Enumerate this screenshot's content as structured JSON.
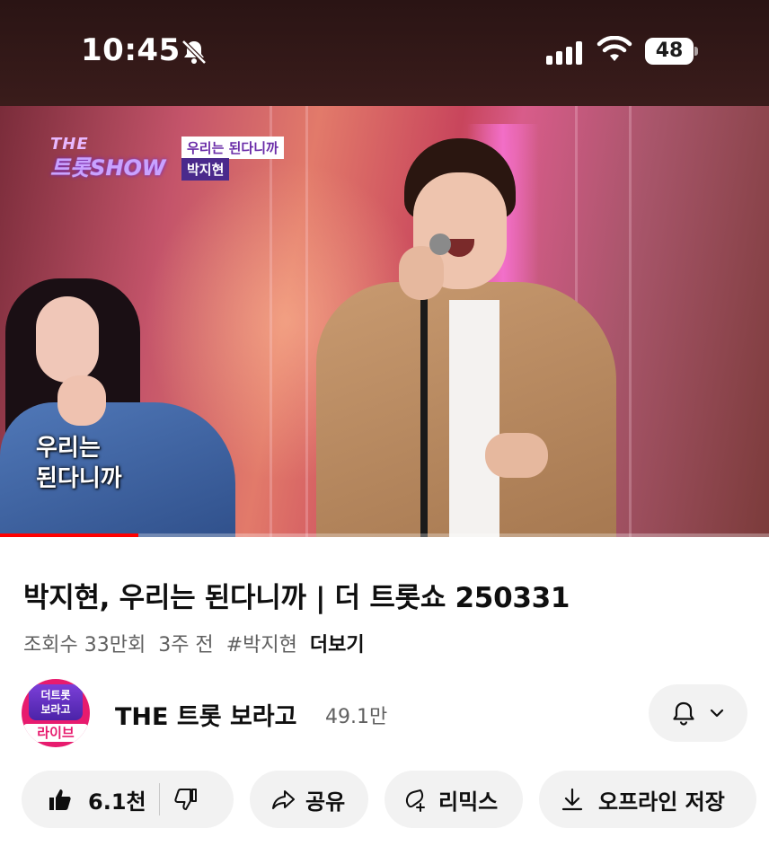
{
  "status_bar": {
    "time": "10:45",
    "battery": "48"
  },
  "video": {
    "show_logo_top": "THE",
    "show_logo_main": "트롯SHOW",
    "song_tag": "우리는 된다니까",
    "artist_tag": "박지현",
    "caption_line1": "우리는",
    "caption_line2": "된다니까",
    "progress_fraction": 0.18
  },
  "video_info": {
    "title": "박지현, 우리는 된다니까 | 더 트롯쇼 250331",
    "views": "조회수 33만회",
    "age": "3주 전",
    "hashtag": "#박지현",
    "more": "더보기"
  },
  "channel": {
    "avatar_text": "더트롯\n보라고",
    "avatar_badge": "라이브",
    "name": "THE 트롯 보라고",
    "subscribers": "49.1만"
  },
  "actions": {
    "like_count": "6.1천",
    "share": "공유",
    "remix": "리믹스",
    "offline": "오프라인 저장"
  },
  "colors": {
    "accent": "#ff0000",
    "avatar": "#e71b6e",
    "pill_bg": "#f2f2f2"
  }
}
